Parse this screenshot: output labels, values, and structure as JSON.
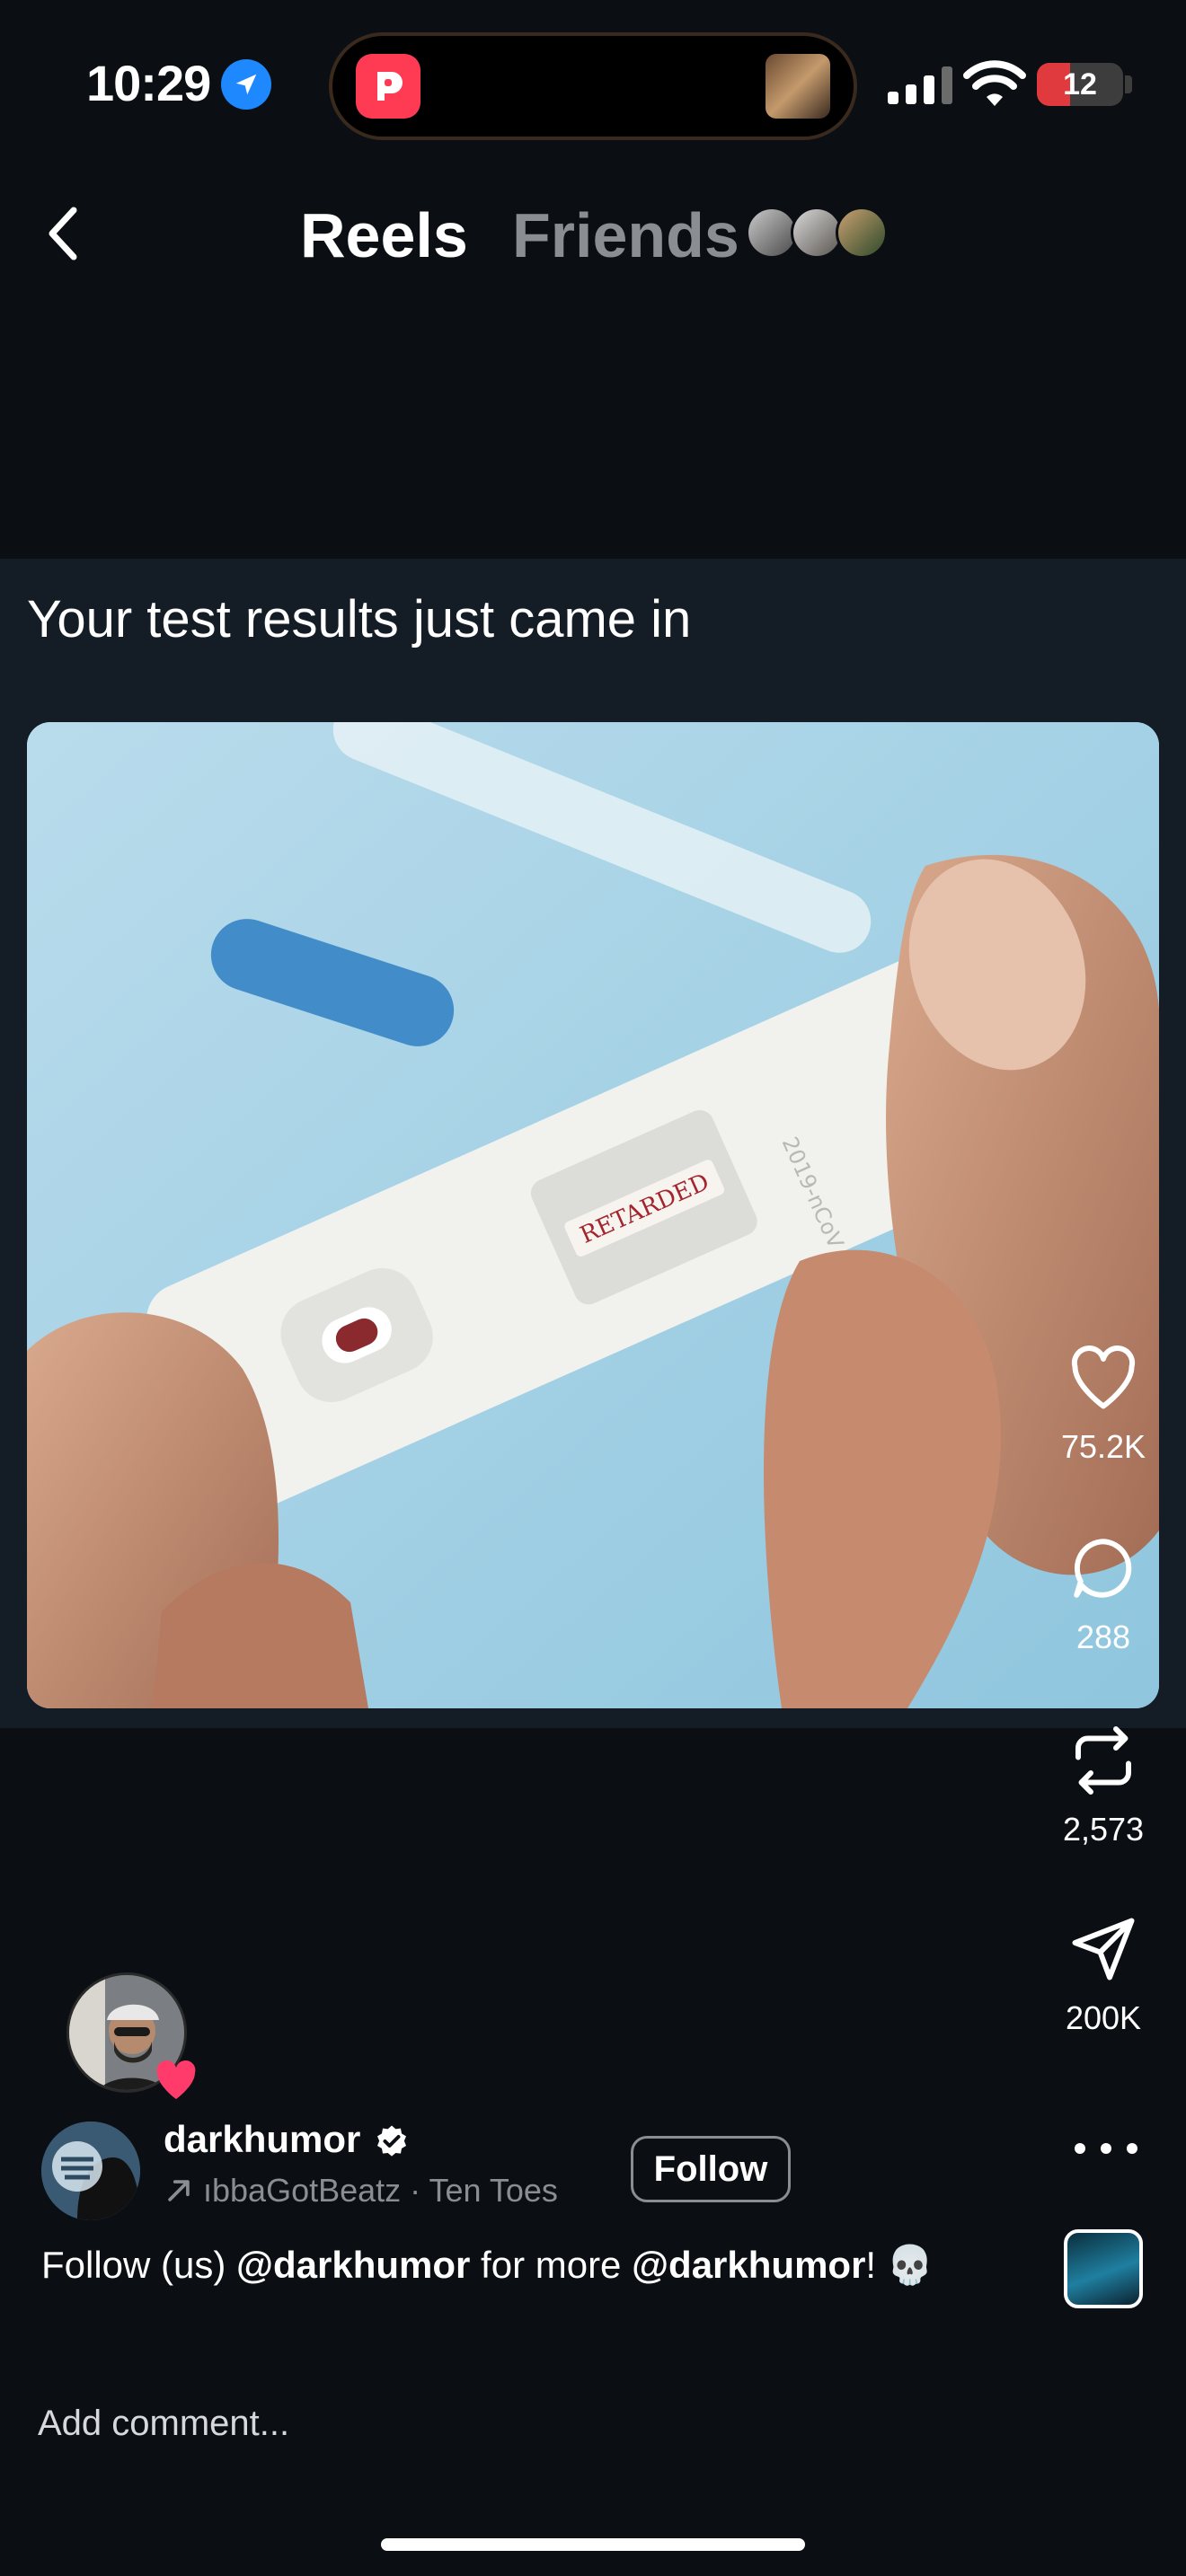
{
  "status_bar": {
    "time": "10:29",
    "battery_level": "12",
    "battery_fraction": 0.12
  },
  "header": {
    "tabs": [
      {
        "label": "Reels",
        "active": true
      },
      {
        "label": "Friends",
        "active": false
      }
    ]
  },
  "post": {
    "caption": "Your test results just came in",
    "image_text": "RETARDED"
  },
  "actions": {
    "likes": "75.2K",
    "comments": "288",
    "reposts": "2,573",
    "shares": "200K"
  },
  "author": {
    "name": "darkhumor",
    "audio_text": "ıbbaGotBeatz · Ten Toes",
    "follow_label": "Follow"
  },
  "description": {
    "part1": "Follow (us) ",
    "mention1": "@darkhumor",
    "part2": " for more ",
    "mention2": "@darkhumor",
    "part3": "! ",
    "emoji": "💀"
  },
  "comment": {
    "placeholder": "Add comment..."
  },
  "colors": {
    "background": "#0b0f13",
    "post_band": "#141d26",
    "battery_red": "#e0393e",
    "location_blue": "#1e88ff",
    "heart_pink": "#ff3b6b"
  },
  "icons": [
    "location-arrow-icon",
    "threads-app-icon",
    "signal-icon",
    "wifi-icon",
    "battery-icon",
    "chevron-left-icon",
    "heart-icon",
    "comment-icon",
    "repost-icon",
    "share-icon",
    "more-icon",
    "verified-icon",
    "audio-arrow-icon",
    "skull-emoji"
  ]
}
